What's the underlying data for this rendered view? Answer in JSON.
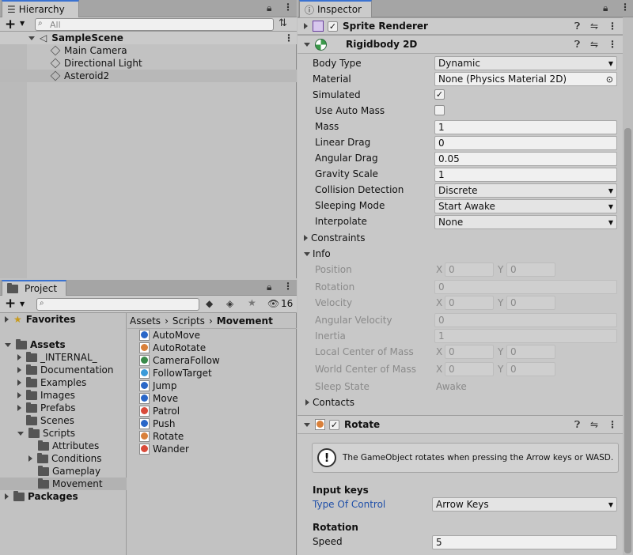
{
  "hierarchy": {
    "tab_label": "Hierarchy",
    "add_label": "+",
    "search_placeholder": "All",
    "scene_name": "SampleScene",
    "items": [
      {
        "label": "Main Camera"
      },
      {
        "label": "Directional Light"
      },
      {
        "label": "Asteroid2"
      }
    ]
  },
  "project": {
    "tab_label": "Project",
    "add_label": "+",
    "search_placeholder": "",
    "hidden_count": "16",
    "favorites": "Favorites",
    "assets": "Assets",
    "asset_folders": [
      "_INTERNAL_",
      "Documentation",
      "Examples",
      "Images",
      "Prefabs",
      "Scenes"
    ],
    "scripts": "Scripts",
    "script_folders": [
      "Attributes",
      "Conditions",
      "Gameplay",
      "Movement"
    ],
    "packages": "Packages",
    "breadcrumb": [
      "Assets",
      "Scripts",
      "Movement"
    ],
    "breadcrumb_sep": "›",
    "files": [
      {
        "label": "AutoMove",
        "color": "#2a67c8"
      },
      {
        "label": "AutoRotate",
        "color": "#d9803a"
      },
      {
        "label": "CameraFollow",
        "color": "#3a8a4a"
      },
      {
        "label": "FollowTarget",
        "color": "#3a9ad9"
      },
      {
        "label": "Jump",
        "color": "#2a67c8"
      },
      {
        "label": "Move",
        "color": "#2a67c8"
      },
      {
        "label": "Patrol",
        "color": "#d94a3a"
      },
      {
        "label": "Push",
        "color": "#2a67c8"
      },
      {
        "label": "Rotate",
        "color": "#d9803a"
      },
      {
        "label": "Wander",
        "color": "#d94a3a"
      }
    ]
  },
  "inspector": {
    "tab_label": "Inspector",
    "sprite_renderer": "Sprite Renderer",
    "rigidbody": {
      "title": "Rigidbody 2D",
      "body_type_label": "Body Type",
      "body_type": "Dynamic",
      "material_label": "Material",
      "material": "None (Physics Material 2D)",
      "simulated_label": "Simulated",
      "use_auto_mass_label": "Use Auto Mass",
      "mass_label": "Mass",
      "mass": "1",
      "linear_drag_label": "Linear Drag",
      "linear_drag": "0",
      "angular_drag_label": "Angular Drag",
      "angular_drag": "0.05",
      "gravity_scale_label": "Gravity Scale",
      "gravity_scale": "1",
      "collision_label": "Collision Detection",
      "collision": "Discrete",
      "sleeping_label": "Sleeping Mode",
      "sleeping": "Start Awake",
      "interpolate_label": "Interpolate",
      "interpolate": "None",
      "constraints_label": "Constraints",
      "info_label": "Info",
      "position_label": "Position",
      "rotation_label": "Rotation",
      "rotation": "0",
      "velocity_label": "Velocity",
      "angular_velocity_label": "Angular Velocity",
      "angular_velocity": "0",
      "inertia_label": "Inertia",
      "inertia": "1",
      "local_com_label": "Local Center of Mass",
      "world_com_label": "World Center of Mass",
      "sleep_state_label": "Sleep State",
      "sleep_state": "Awake",
      "contacts_label": "Contacts",
      "x": "X",
      "y": "Y",
      "zero": "0"
    },
    "rotate": {
      "title": "Rotate",
      "help": "The GameObject rotates when pressing the Arrow keys or WASD.",
      "input_keys_header": "Input keys",
      "type_of_control_label": "Type Of Control",
      "type_of_control": "Arrow Keys",
      "rotation_header": "Rotation",
      "speed_label": "Speed",
      "speed": "5"
    }
  },
  "colors": {
    "accent": "#3a72d1",
    "link_label": "#1f4fa8",
    "selection": "#b8b8b8"
  }
}
